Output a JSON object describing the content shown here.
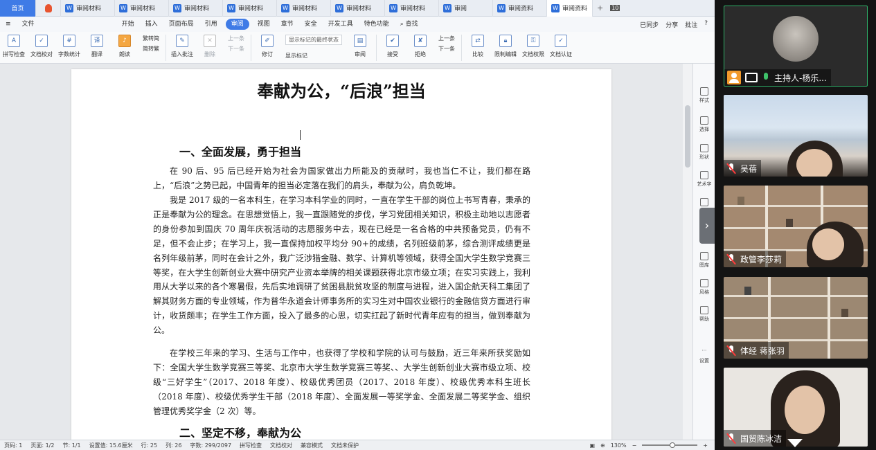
{
  "tabs": [
    {
      "label": "首页",
      "kind": "home"
    },
    {
      "label": "",
      "kind": "fav"
    },
    {
      "label": "审阅材料"
    },
    {
      "label": "审阅材料"
    },
    {
      "label": "审阅材料"
    },
    {
      "label": "审阅材料"
    },
    {
      "label": "审阅材料"
    },
    {
      "label": "审阅材料"
    },
    {
      "label": "审阅材料"
    },
    {
      "label": "审阅"
    },
    {
      "label": "审阅资料"
    },
    {
      "label": "审阅资料",
      "active": true
    }
  ],
  "tab_controls": {
    "new": "+",
    "count": "10"
  },
  "menu": {
    "file": "文件",
    "items": [
      "开始",
      "插入",
      "页面布局",
      "引用",
      "审阅",
      "视图",
      "章节",
      "安全",
      "开发工具",
      "特色功能"
    ],
    "active_index": 4,
    "search": "查找",
    "sync": "已同步",
    "share": "分享",
    "comment": "批注",
    "help": "?"
  },
  "ribbon": {
    "spellcheck": "拼写检查",
    "doc_proof": "文档校对",
    "word_count": "字数统计",
    "translate": "翻译",
    "read_aloud": "朗读",
    "trad_simp_1": "繁转简",
    "trad_simp_2": "简转繁",
    "insert_comment": "插入批注",
    "delete": "删除",
    "prev_comment": "上一条",
    "next_comment": "下一条",
    "track": "修订",
    "markup_state": "显示标记的最终状态",
    "show_markup": "显示标记",
    "review": "审阅",
    "accept": "接受",
    "reject": "拒绝",
    "prev_change": "上一条",
    "next_change": "下一条",
    "compare": "比较",
    "restrict": "限制编辑",
    "doc_permission": "文档权限",
    "doc_cert": "文档认证"
  },
  "document": {
    "title": "奉献为公，“后浪”担当",
    "heading1": "一、全面发展，勇于担当",
    "p1": "在 90 后、95 后已经开始为社会为国家做出力所能及的贡献时，我也当仁不让，我们都在路上，“后浪”之势已起，中国青年的担当必定落在我们的肩头，奉献为公，肩负乾坤。",
    "p2": "我是 2017 级的一名本科生，在学习本科学业的同时，一直在学生干部的岗位上书写青春，秉承的正是奉献为公的理念。在思想觉悟上，我一直跟随党的步伐，学习党团相关知识，积极主动地以志愿者的身份参加到国庆 70 周年庆祝活动的志愿服务中去，现在已经是一名合格的中共预备党员，仍有不足，但不会止步；在学习上，我一直保持加权平均分 90+的成绩，名列班级前茅，综合测评成绩更是名列年级前茅，同时在会计之外，我广泛涉猎金融、数学、计算机等领域，获得全国大学生数学竞赛三等奖，在大学生创新创业大赛中研究产业资本举牌的相关课题获得北京市级立项；在实习实践上，我利用从大学以来的各个寒暑假，先后实地调研了贫困县脱贫攻坚的制度与进程，进入国企航天科工集团了解其财务方面的专业领域，作为普华永道会计师事务所的实习生对中国农业银行的金融信贷方面进行审计，收货颇丰；在学生工作方面，投入了最多的心思，切实扛起了新时代青年应有的担当，做到奉献为公。",
    "p3": "在学校三年来的学习、生活与工作中，也获得了学校和学院的认可与鼓励，近三年来所获奖励如下：全国大学生数学竞赛三等奖、北京市大学生数学竞赛三等奖、、大学生创新创业大赛市级立项、校级“三好学生”（2017、2018 年度）、校级优秀团员（2017、2018 年度）、校级优秀本科生班长（2018 年度）、校级优秀学生干部（2018 年度）、全面发展一等奖学金、全面发展二等奖学金、组织管理优秀奖学金（2 次）等。",
    "heading2": "二、坚定不移，奉献为公"
  },
  "taskpane": [
    "样式",
    "选择",
    "形状",
    "艺术字",
    "图表",
    "图库",
    "风格",
    "帮助",
    "设置"
  ],
  "status": {
    "page": "页码: 1",
    "pages": "页面: 1/2",
    "section": "节: 1/1",
    "setting": "设置值: 15.6厘米",
    "row": "行: 25",
    "col": "列: 26",
    "words": "字数: 299/2097",
    "spell": "拼写检查",
    "proof": "文档校对",
    "compat": "兼容模式",
    "unprotected": "文档未保护",
    "zoom": "130%"
  },
  "meeting": {
    "participants": [
      {
        "name": "主持人-杨乐...",
        "host": true,
        "mic": "on"
      },
      {
        "name": "吴蓓",
        "mic": "muted"
      },
      {
        "name": "政管李莎莉",
        "mic": "muted"
      },
      {
        "name": "体经 蒋张羽",
        "mic": "muted"
      },
      {
        "name": "国贸陈冰洁",
        "mic": "muted"
      }
    ]
  },
  "colors": {
    "accent": "#3f7be6",
    "active_speaker": "#2fb36a",
    "muted": "#ff3b3b"
  }
}
